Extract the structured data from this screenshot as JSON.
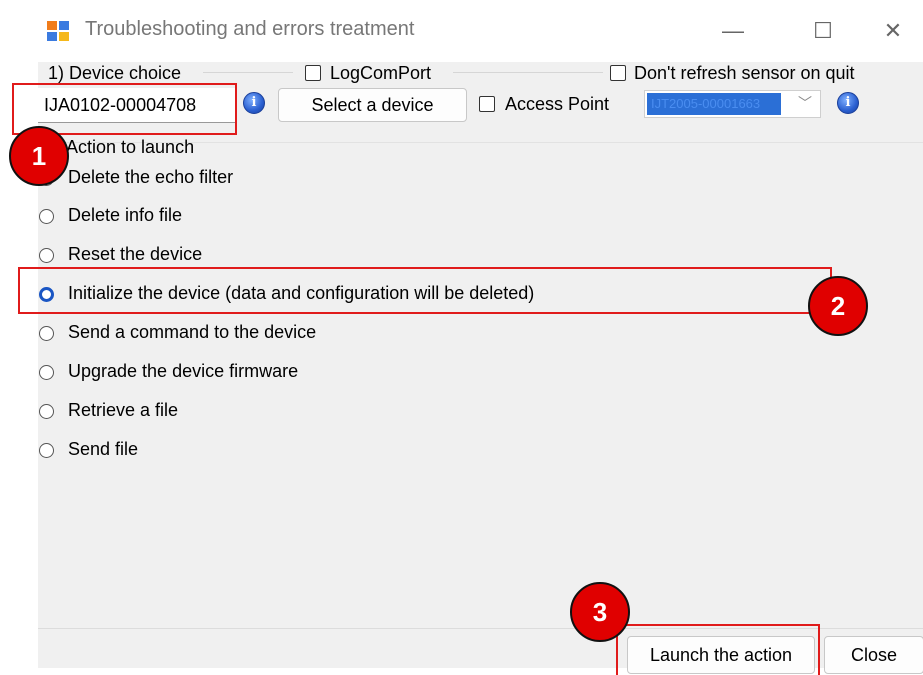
{
  "window": {
    "title": "Troubleshooting and errors treatment",
    "minimize": "—",
    "maximize": "☐",
    "close": "✕"
  },
  "device_choice": {
    "group_label": "1) Device choice",
    "device_id": "IJA0102-00004708",
    "logcomport_label": "LogComPort",
    "dont_refresh_label": "Don't refresh sensor on quit",
    "select_button": "Select a device",
    "access_point_label": "Access Point",
    "access_point_value": "IJT2005-00001663"
  },
  "actions": {
    "group_label": "Action to launch",
    "selected_index": 3,
    "options": [
      "Delete the echo filter",
      "Delete info file",
      "Reset the device",
      "Initialize the device (data and configuration will be deleted)",
      "Send a command to the device",
      "Upgrade the device firmware",
      "Retrieve a file",
      "Send file"
    ]
  },
  "footer": {
    "launch_button": "Launch the action",
    "close_button": "Close"
  },
  "annotations": {
    "badge_1": "1",
    "badge_2": "2",
    "badge_3": "3",
    "color": "#e00000"
  }
}
